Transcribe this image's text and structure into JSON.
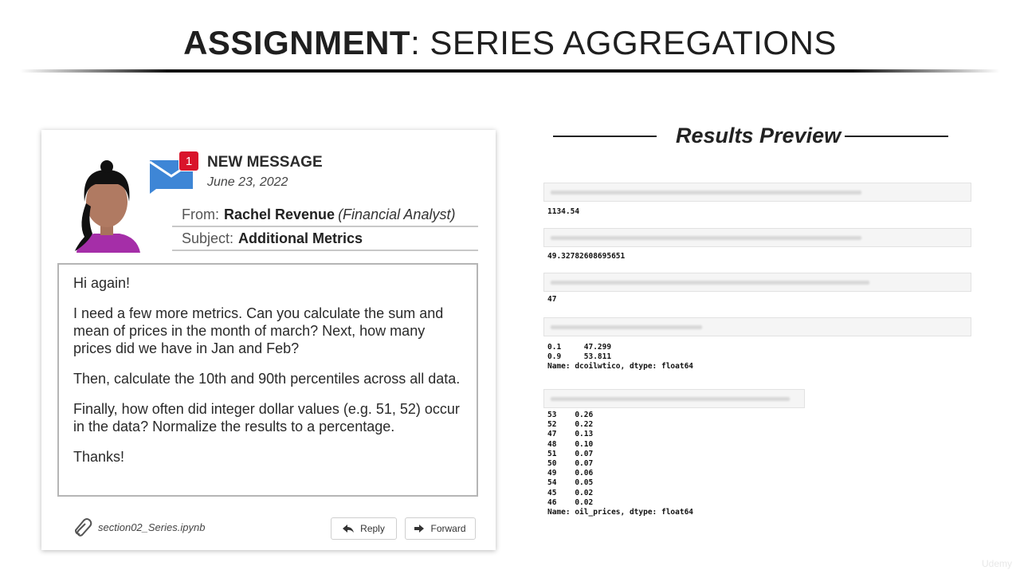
{
  "title": {
    "bold": "ASSIGNMENT",
    "rest": ": SERIES AGGREGATIONS"
  },
  "message": {
    "badge_count": "1",
    "header": "NEW MESSAGE",
    "date": "June 23, 2022",
    "from_label": "From:",
    "from_name": "Rachel Revenue",
    "from_role": "(Financial Analyst)",
    "subject_label": "Subject:",
    "subject": "Additional Metrics",
    "body": [
      "Hi again!",
      "I need a few more metrics. Can you calculate the sum and mean of prices in the month of march? Next, how many prices did we have in Jan and Feb?",
      "Then, calculate the 10th and 90th percentiles across all data.",
      "Finally, how often did integer dollar values (e.g. 51, 52) occur in the data? Normalize the results to a percentage.",
      "Thanks!"
    ],
    "attachment": "section02_Series.ipynb",
    "reply_label": "Reply",
    "forward_label": "Forward",
    "icons": {
      "mail": "mail-icon",
      "attachment": "paperclip-icon",
      "reply": "reply-arrow-icon",
      "forward": "forward-arrow-icon"
    }
  },
  "results": {
    "title": "Results Preview",
    "outputs": [
      "1134.54",
      "49.32782608695651",
      "47",
      "0.1     47.299\n0.9     53.811\nName: dcoilwtico, dtype: float64",
      "53    0.26\n52    0.22\n47    0.13\n48    0.10\n51    0.07\n50    0.07\n49    0.06\n54    0.05\n45    0.02\n46    0.02\nName: oil_prices, dtype: float64"
    ]
  },
  "watermark": "Udemy"
}
